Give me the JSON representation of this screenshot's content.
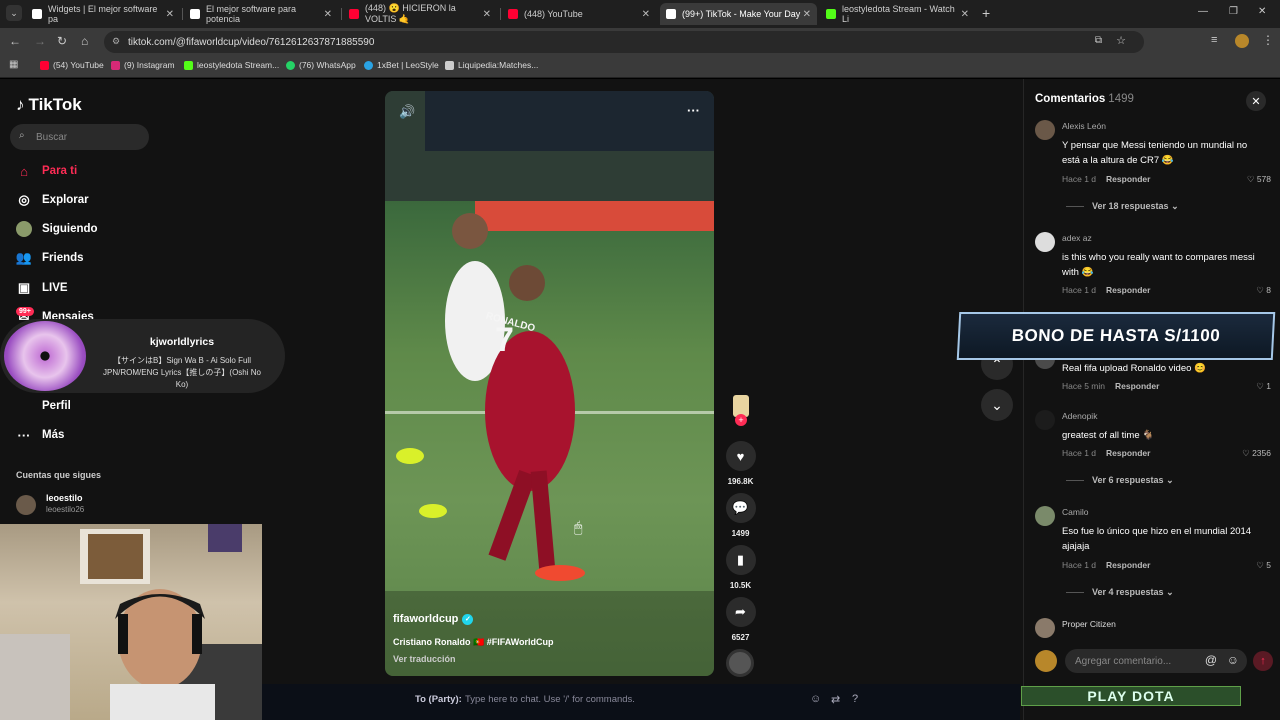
{
  "browser": {
    "tabs": [
      {
        "title": "Widgets | El mejor software pa",
        "color": "#ffffff"
      },
      {
        "title": "El mejor software para potencia",
        "color": "#ffffff"
      },
      {
        "title": "(448) 😮 HICIERON la VOLTIS 🤙",
        "color": "#ff0033"
      },
      {
        "title": "(448) YouTube",
        "color": "#ff0033"
      },
      {
        "title": "(99+) TikTok - Make Your Day",
        "color": "#ffffff"
      },
      {
        "title": "leostyledota Stream - Watch Li",
        "color": "#53fc18"
      }
    ],
    "url": "tiktok.com/@fifaworldcup/video/7612612637871885590",
    "bookmarks": [
      "(54) YouTube",
      "(9) Instagram",
      "leostyledota Stream...",
      "(76) WhatsApp",
      "1xBet | LeoStyle",
      "Liquipedia:Matches..."
    ]
  },
  "sidebar": {
    "logo": "TikTok",
    "search_placeholder": "Buscar",
    "nav": [
      {
        "label": "Para ti",
        "icon": "home-icon"
      },
      {
        "label": "Explorar",
        "icon": "compass-icon"
      },
      {
        "label": "Siguiendo",
        "icon": "following-icon"
      },
      {
        "label": "Friends",
        "icon": "friends-icon"
      },
      {
        "label": "LIVE",
        "icon": "live-icon"
      },
      {
        "label": "Mensajes",
        "icon": "messages-icon"
      },
      {
        "label": "Perfil",
        "icon": "profile-icon"
      },
      {
        "label": "Más",
        "icon": "more-icon"
      }
    ],
    "messages_badge": "99+",
    "following_title": "Cuentas que sigues",
    "following_user": {
      "name": "leoestilo",
      "handle": "leoestilo26"
    }
  },
  "music_popup": {
    "artist": "kjworldlyrics",
    "song": "【サインはB】Sign Wa B - Ai Solo Full JPN/ROM/ENG Lyrics【推しの子】(Oshi No Ko)"
  },
  "video": {
    "author": "fifaworldcup",
    "caption": "Cristiano Ronaldo 🇵🇹 #FIFAWorldCup",
    "translate": "Ver traducción",
    "jersey": "7",
    "jersey_name": "RONALDO"
  },
  "actions": {
    "likes": "196.8K",
    "comments": "1499",
    "saves": "10.5K",
    "shares": "6527"
  },
  "comments": {
    "title": "Comentarios",
    "count": "1499",
    "items": [
      {
        "user": "Alexis León",
        "text": "Y pensar que Messi teniendo un mundial no está a la altura de CR7 😂",
        "time": "Hace 1 d",
        "reply": "Responder",
        "likes": "578",
        "more": "Ver 18 respuestas"
      },
      {
        "user": "adex az",
        "text": "is this who you really want to compares messi with 😂",
        "time": "Hace 1 d",
        "reply": "Responder",
        "likes": "8",
        "more": ""
      },
      {
        "user": "",
        "text": "Real fifa upload Ronaldo video 😊",
        "time": "Hace 5 min",
        "reply": "Responder",
        "likes": "1",
        "more": ""
      },
      {
        "user": "Adenopik",
        "text": "greatest of all time 🐐",
        "time": "Hace 1 d",
        "reply": "Responder",
        "likes": "2356",
        "more": "Ver 6 respuestas"
      },
      {
        "user": "Camilo",
        "text": "Eso fue lo único que hizo en el mundial 2014 ajajaja",
        "time": "Hace 1 d",
        "reply": "Responder",
        "likes": "5",
        "more": "Ver 4 respuestas"
      },
      {
        "user": "Proper Citizen",
        "text": "",
        "time": "",
        "reply": "",
        "likes": "",
        "more": ""
      }
    ],
    "input_placeholder": "Agregar comentario..."
  },
  "overlay": {
    "banner": "BONO DE HASTA S/1100",
    "chat_prefix": "To (Party):",
    "chat_placeholder": "Type here to chat. Use '/' for commands.",
    "play_button": "PLAY DOTA"
  }
}
